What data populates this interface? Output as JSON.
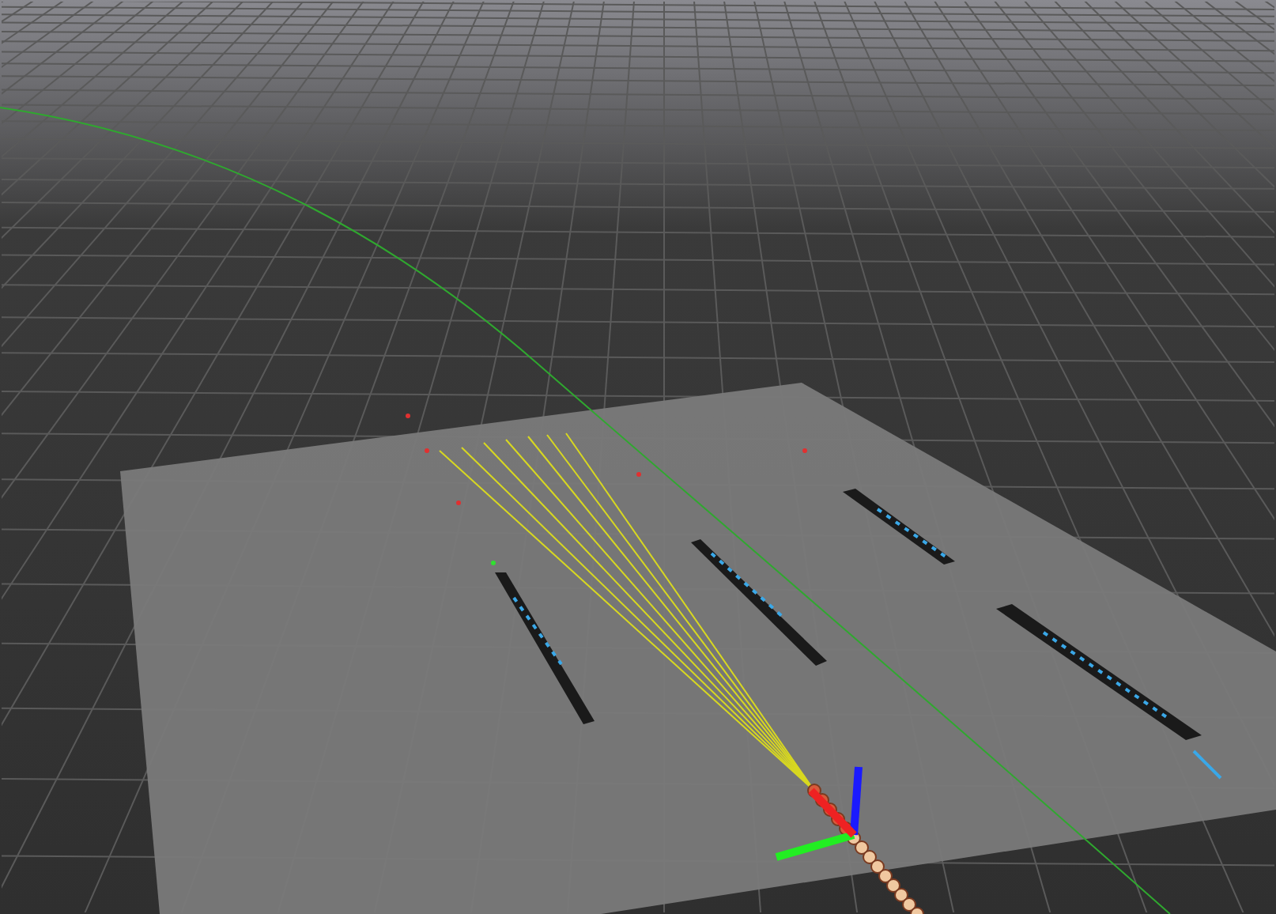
{
  "scene": {
    "kind": "viewport"
  }
}
